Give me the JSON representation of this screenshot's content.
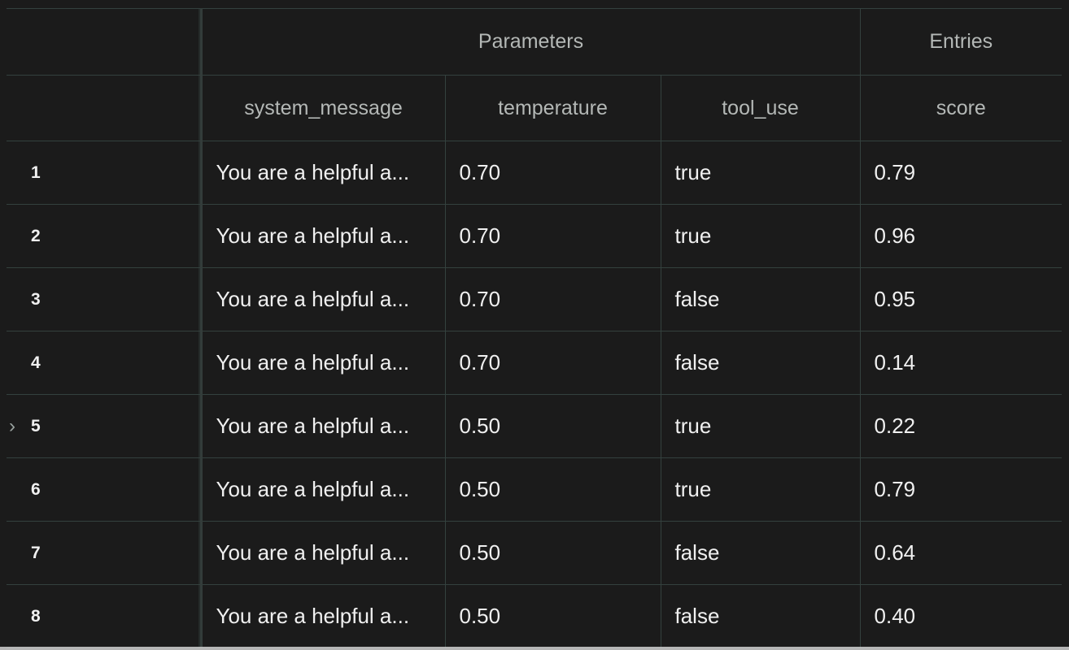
{
  "header": {
    "groups": [
      {
        "label": "",
        "span": 1
      },
      {
        "label": "Parameters",
        "span": 3
      },
      {
        "label": "Entries",
        "span": 1
      }
    ],
    "columns": [
      "",
      "system_message",
      "temperature",
      "tool_use",
      "score"
    ]
  },
  "rows": [
    {
      "index": "1",
      "system_message": "You are a helpful a...",
      "temperature": "0.70",
      "tool_use": "true",
      "score": "0.79"
    },
    {
      "index": "2",
      "system_message": "You are a helpful a...",
      "temperature": "0.70",
      "tool_use": "true",
      "score": "0.96"
    },
    {
      "index": "3",
      "system_message": "You are a helpful a...",
      "temperature": "0.70",
      "tool_use": "false",
      "score": "0.95"
    },
    {
      "index": "4",
      "system_message": "You are a helpful a...",
      "temperature": "0.70",
      "tool_use": "false",
      "score": "0.14"
    },
    {
      "index": "5",
      "system_message": "You are a helpful a...",
      "temperature": "0.50",
      "tool_use": "true",
      "score": "0.22"
    },
    {
      "index": "6",
      "system_message": "You are a helpful a...",
      "temperature": "0.50",
      "tool_use": "true",
      "score": "0.79"
    },
    {
      "index": "7",
      "system_message": "You are a helpful a...",
      "temperature": "0.50",
      "tool_use": "false",
      "score": "0.64"
    },
    {
      "index": "8",
      "system_message": "You are a helpful a...",
      "temperature": "0.50",
      "tool_use": "false",
      "score": "0.40"
    }
  ],
  "hovered_row": 4,
  "icons": {
    "expand": "chevron-right-icon"
  },
  "colors": {
    "background": "#1b1b1b",
    "grid": "#34413e",
    "header_text": "#b4b8b6",
    "cell_text": "#f0f0f0"
  }
}
